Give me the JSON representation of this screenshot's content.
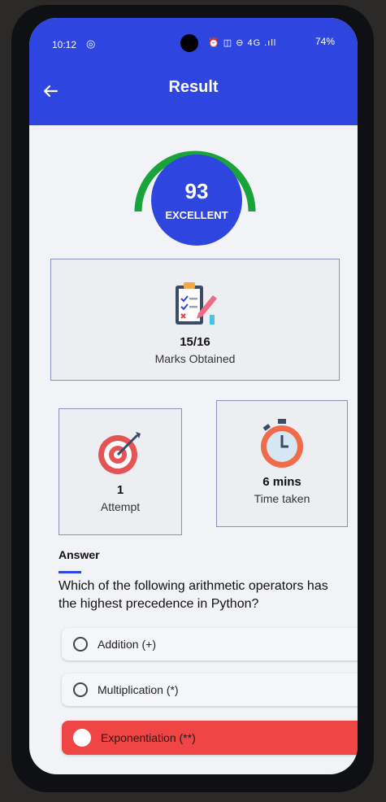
{
  "status": {
    "time": "10:12",
    "indicators": "4G .ıll",
    "battery": "74%"
  },
  "header": {
    "title": "Result",
    "back_icon": "arrow-left-icon"
  },
  "score": {
    "value": "93",
    "label": "EXCELLENT",
    "fraction": 0.93,
    "gauge_color": "#1aa33a",
    "circle_color": "#2f45e0"
  },
  "marks_card": {
    "value": "15/16",
    "caption": "Marks Obtained",
    "icon": "clipboard-checklist-icon"
  },
  "attempt_card": {
    "value": "1",
    "caption": "Attempt",
    "icon": "target-icon"
  },
  "time_card": {
    "value": "6 mins",
    "caption": "Time taken",
    "icon": "stopwatch-icon"
  },
  "answer": {
    "section_label": "Answer",
    "question": "Which of the following arithmetic operators has the highest precedence in Python?",
    "options": [
      "Addition (+)",
      "Multiplication (*)",
      "Exponentiation (**)"
    ],
    "selected_index": 2,
    "selected_color": "#f04545"
  }
}
